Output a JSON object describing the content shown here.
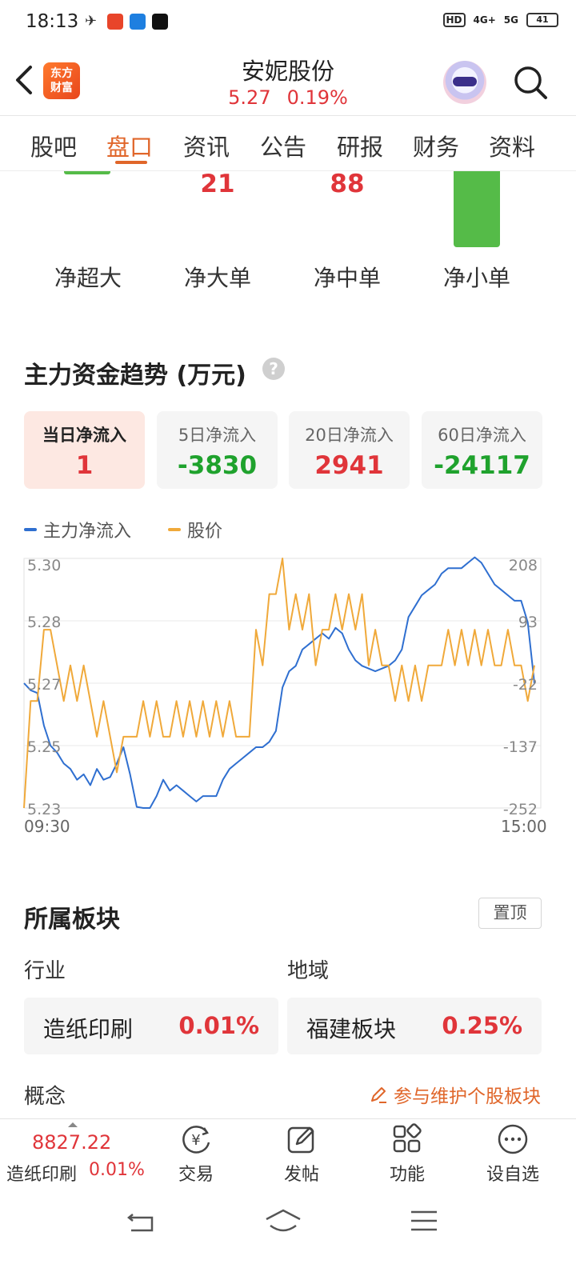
{
  "status_bar": {
    "time": "18:13",
    "right_indicators": [
      "HD",
      "4G+",
      "5G"
    ],
    "battery": "41"
  },
  "header": {
    "logo_text": "东方\n财富",
    "stock_name": "安妮股份",
    "price": "5.27",
    "change_pct": "0.19%"
  },
  "tabs": [
    {
      "label": "股吧",
      "active": false
    },
    {
      "label": "盘口",
      "active": true
    },
    {
      "label": "资讯",
      "active": false
    },
    {
      "label": "公告",
      "active": false
    },
    {
      "label": "研报",
      "active": false
    },
    {
      "label": "财务",
      "active": false
    },
    {
      "label": "资料",
      "active": false
    }
  ],
  "fund_flow": {
    "items": [
      {
        "label": "净超大",
        "value": ""
      },
      {
        "label": "净大单",
        "value": "21"
      },
      {
        "label": "净中单",
        "value": "88"
      },
      {
        "label": "净小单",
        "value": ""
      }
    ]
  },
  "trend": {
    "title": "主力资金趋势 (万元)",
    "help_icon": "?",
    "cards": [
      {
        "label": "当日净流入",
        "value": "1",
        "color": "red",
        "active": true
      },
      {
        "label": "5日净流入",
        "value": "-3830",
        "color": "green",
        "active": false
      },
      {
        "label": "20日净流入",
        "value": "2941",
        "color": "red",
        "active": false
      },
      {
        "label": "60日净流入",
        "value": "-24117",
        "color": "green",
        "active": false
      }
    ],
    "legend": [
      {
        "name": "主力净流入",
        "color": "#2f6fd0"
      },
      {
        "name": "股价",
        "color": "#f0a93a"
      }
    ],
    "time_start": "09:30",
    "time_end": "15:00"
  },
  "chart_data": {
    "type": "line",
    "x_range": [
      "09:30",
      "15:00"
    ],
    "y_left_ticks": [
      "5.30",
      "5.28",
      "5.27",
      "5.25",
      "5.23"
    ],
    "y_right_ticks": [
      "208",
      "93",
      "-22",
      "-137",
      "-252"
    ],
    "ylim_left": [
      5.23,
      5.3
    ],
    "ylim_right": [
      -252,
      208
    ],
    "grid": true,
    "series": [
      {
        "name": "主力净流入",
        "color": "#2f6fd0",
        "axis": "right",
        "values": [
          -22,
          -35,
          -40,
          -100,
          -137,
          -150,
          -170,
          -180,
          -200,
          -190,
          -210,
          -180,
          -200,
          -195,
          -170,
          -140,
          -190,
          -250,
          -252,
          -252,
          -230,
          -200,
          -220,
          -210,
          -220,
          -230,
          -240,
          -230,
          -230,
          -230,
          -200,
          -180,
          -170,
          -160,
          -150,
          -140,
          -140,
          -130,
          -110,
          -30,
          0,
          10,
          40,
          50,
          60,
          70,
          60,
          80,
          70,
          40,
          20,
          10,
          5,
          0,
          5,
          10,
          20,
          40,
          100,
          120,
          140,
          150,
          160,
          180,
          190,
          190,
          190,
          200,
          210,
          200,
          180,
          160,
          150,
          140,
          130,
          130,
          90,
          -22
        ]
      },
      {
        "name": "股价",
        "color": "#f0a93a",
        "axis": "left",
        "values": [
          5.23,
          5.26,
          5.26,
          5.28,
          5.28,
          5.27,
          5.26,
          5.27,
          5.26,
          5.27,
          5.26,
          5.25,
          5.26,
          5.25,
          5.24,
          5.25,
          5.25,
          5.25,
          5.26,
          5.25,
          5.26,
          5.25,
          5.25,
          5.26,
          5.25,
          5.26,
          5.25,
          5.26,
          5.25,
          5.26,
          5.25,
          5.26,
          5.25,
          5.25,
          5.25,
          5.28,
          5.27,
          5.29,
          5.29,
          5.3,
          5.28,
          5.29,
          5.28,
          5.29,
          5.27,
          5.28,
          5.28,
          5.29,
          5.28,
          5.29,
          5.28,
          5.29,
          5.27,
          5.28,
          5.27,
          5.27,
          5.26,
          5.27,
          5.26,
          5.27,
          5.26,
          5.27,
          5.27,
          5.27,
          5.28,
          5.27,
          5.28,
          5.27,
          5.28,
          5.27,
          5.28,
          5.27,
          5.27,
          5.28,
          5.27,
          5.27,
          5.26,
          5.27
        ]
      }
    ]
  },
  "sectors": {
    "title": "所属板块",
    "pin_label": "置顶",
    "industry_label": "行业",
    "region_label": "地域",
    "industry": {
      "name": "造纸印刷",
      "pct": "0.01%"
    },
    "region": {
      "name": "福建板块",
      "pct": "0.25%"
    },
    "concept_label": "概念",
    "maintain_label": "参与维护个股板块"
  },
  "bottom_bar": {
    "index_value": "8827.22",
    "index_name": "造纸印刷",
    "index_pct": "0.01%",
    "buttons": [
      {
        "label": "交易",
        "icon": "yuan-refresh-icon"
      },
      {
        "label": "发帖",
        "icon": "edit-icon"
      },
      {
        "label": "功能",
        "icon": "grid-icon"
      },
      {
        "label": "设自选",
        "icon": "more-icon"
      }
    ]
  }
}
